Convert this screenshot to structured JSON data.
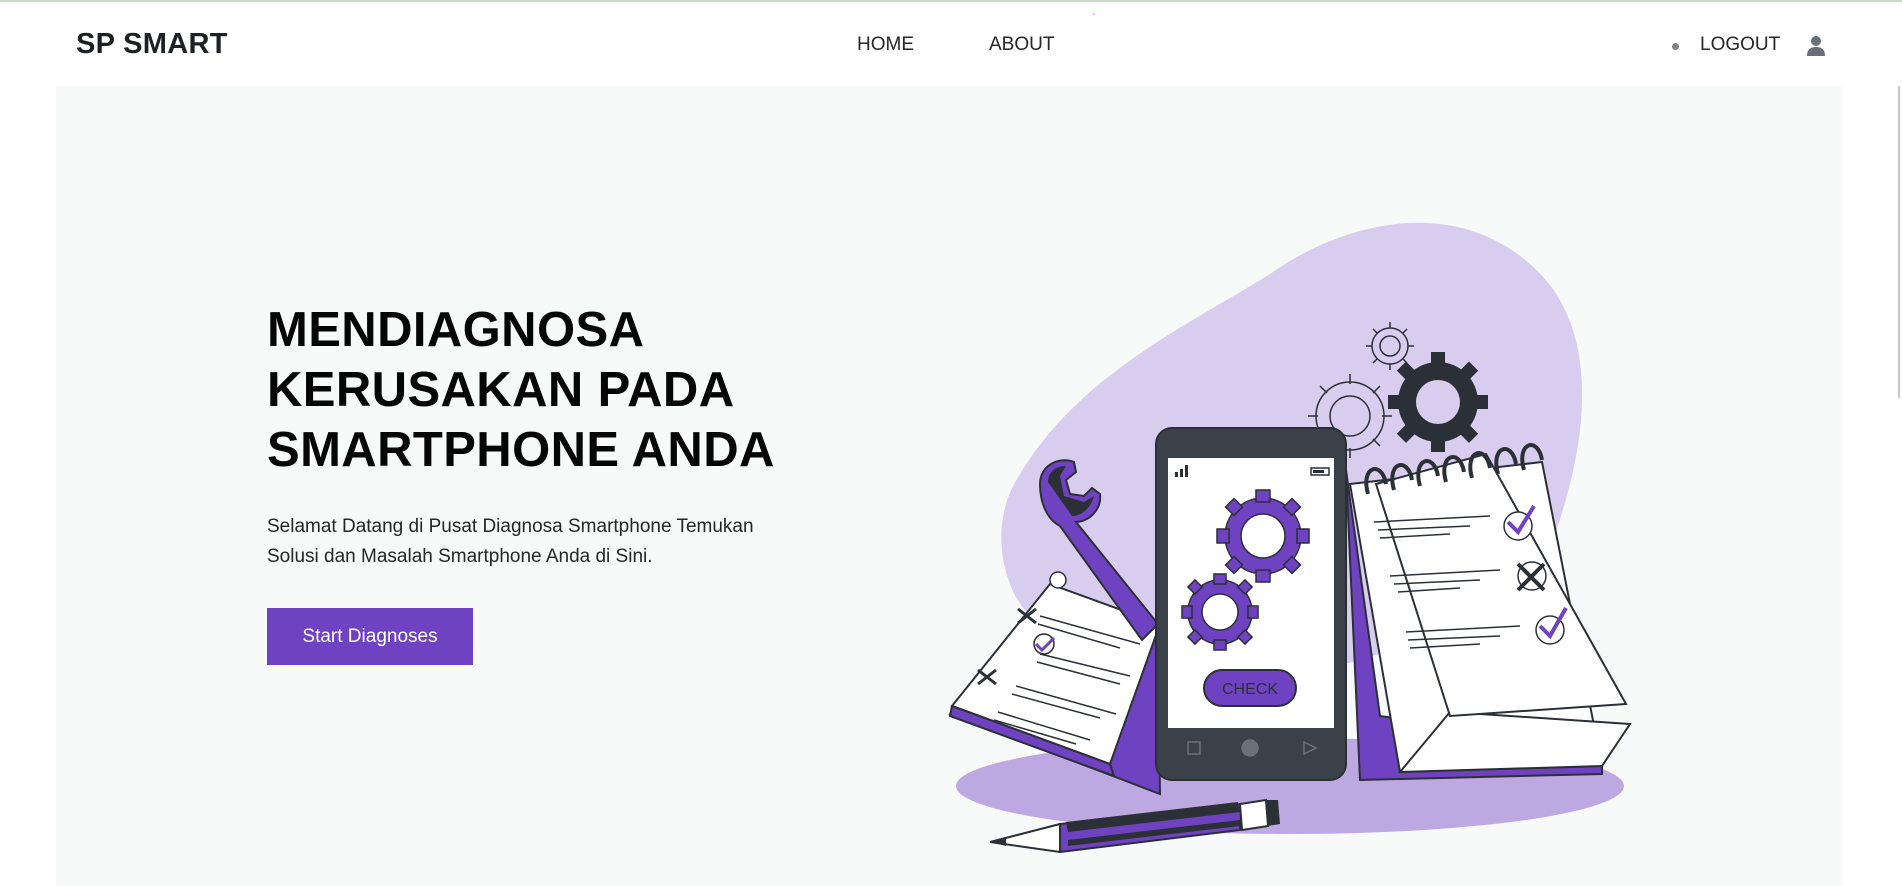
{
  "brand": "SP SMART",
  "nav": {
    "home": "HOME",
    "about": "ABOUT",
    "logout": "LOGOUT"
  },
  "icons": {
    "user": "user-icon",
    "dot": "dot-icon"
  },
  "hero": {
    "title_lines": [
      "MENDIAGNOSA",
      "KERUSAKAN PADA",
      "SMARTPHONE ANDA"
    ],
    "subtitle_lines": [
      "Selamat Datang di Pusat Diagnosa Smartphone Temukan",
      "Solusi dan Masalah Smartphone Anda di Sini."
    ],
    "cta_label": "Start Diagnoses"
  },
  "illustration": {
    "check_label": "CHECK"
  },
  "colors": {
    "accent": "#6f42c1",
    "hero_bg": "#f8f9f9",
    "blob": "#d8cdee",
    "shadow": "#bea8e2",
    "dark": "#2b3036"
  }
}
